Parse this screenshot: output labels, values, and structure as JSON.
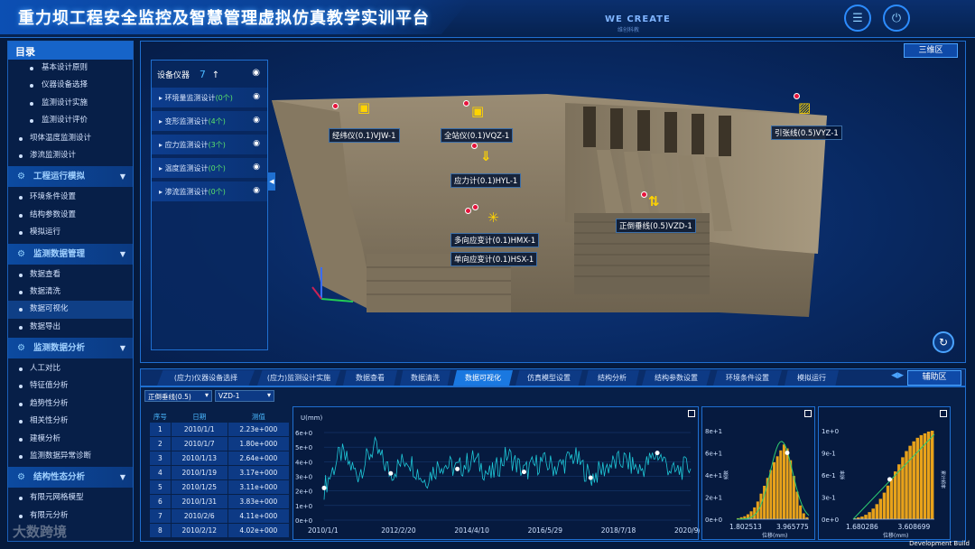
{
  "header": {
    "title": "重力坝工程安全监控及智慧管理虚拟仿真教学实训平台",
    "brand": "WE CREATE",
    "brand_sub": "维创科教",
    "btn_menu_icon": "menu-icon",
    "btn_power_icon": "power-icon"
  },
  "sidebar": {
    "title": "目录",
    "items": [
      {
        "type": "sub",
        "label": "基本设计原则"
      },
      {
        "type": "sub",
        "label": "仪器设备选择"
      },
      {
        "type": "sub",
        "label": "监测设计实施"
      },
      {
        "type": "sub",
        "label": "监测设计评价"
      },
      {
        "type": "item",
        "label": "坝体温度监测设计"
      },
      {
        "type": "item",
        "label": "渗流监测设计"
      },
      {
        "type": "section",
        "label": "工程运行模拟"
      },
      {
        "type": "item",
        "label": "环境条件设置"
      },
      {
        "type": "item",
        "label": "结构参数设置"
      },
      {
        "type": "item",
        "label": "模拟运行"
      },
      {
        "type": "section",
        "label": "监测数据管理"
      },
      {
        "type": "item",
        "label": "数据查看"
      },
      {
        "type": "item",
        "label": "数据清洗"
      },
      {
        "type": "item",
        "label": "数据可视化",
        "active": true
      },
      {
        "type": "item",
        "label": "数据导出"
      },
      {
        "type": "section",
        "label": "监测数据分析"
      },
      {
        "type": "item",
        "label": "人工对比"
      },
      {
        "type": "item",
        "label": "特征值分析"
      },
      {
        "type": "item",
        "label": "趋势性分析"
      },
      {
        "type": "item",
        "label": "相关性分析"
      },
      {
        "type": "item",
        "label": "建模分析"
      },
      {
        "type": "item",
        "label": "监测数据异常诊断"
      },
      {
        "type": "section",
        "label": "结构性态分析"
      },
      {
        "type": "item",
        "label": "有限元网格模型"
      },
      {
        "type": "item",
        "label": "有限元分析"
      }
    ]
  },
  "viewport": {
    "tab_label": "三维区",
    "panel_title": "设备仪器",
    "panel_count": "7",
    "panel_arrow": "↑",
    "rows": [
      {
        "label": "环境量监测设计",
        "count": "(0个)"
      },
      {
        "label": "变形监测设计",
        "count": "(4个)"
      },
      {
        "label": "应力监测设计",
        "count": "(3个)"
      },
      {
        "label": "温度监测设计",
        "count": "(0个)"
      },
      {
        "label": "渗流监测设计",
        "count": "(0个)"
      }
    ],
    "sensors": {
      "s1": "经纬仪(0.1)VJW-1",
      "s2": "全站仪(0.1)VQZ-1",
      "s3": "引张线(0.5)VYZ-1",
      "s4": "应力计(0.1)HYL-1",
      "s5": "正倒垂线(0.5)VZD-1",
      "s6": "多向应变计(0.1)HMX-1",
      "s7": "单向应变计(0.1)HSX-1"
    }
  },
  "tabs": {
    "items": [
      "(应力)仪器设备选择",
      "(应力)监测设计实施",
      "数据查看",
      "数据清洗",
      "数据可视化",
      "仿真模型设置",
      "结构分析",
      "结构参数设置",
      "环境条件设置",
      "模拟运行"
    ],
    "active_index": 4,
    "aux_label": "辅助区"
  },
  "bottom": {
    "select_type": "正倒垂线(0.5)",
    "select_id": "VZD-1",
    "table": {
      "headers": [
        "序号",
        "日期",
        "测值"
      ],
      "rows": [
        [
          "1",
          "2010/1/1",
          "2.23e+000"
        ],
        [
          "2",
          "2010/1/7",
          "1.80e+000"
        ],
        [
          "3",
          "2010/1/13",
          "2.64e+000"
        ],
        [
          "4",
          "2010/1/19",
          "3.17e+000"
        ],
        [
          "5",
          "2010/1/25",
          "3.11e+000"
        ],
        [
          "6",
          "2010/1/31",
          "3.83e+000"
        ],
        [
          "7",
          "2010/2/6",
          "4.11e+000"
        ],
        [
          "8",
          "2010/2/12",
          "4.02e+000"
        ]
      ]
    }
  },
  "chart_data": [
    {
      "type": "line",
      "ylabel": "U(mm)",
      "ylim": [
        0,
        6
      ],
      "yticks": [
        "6e+0",
        "5e+0",
        "4e+0",
        "3e+0",
        "2e+0",
        "1e+0",
        "0e+0"
      ],
      "xticks": [
        "2010/1/1",
        "2012/2/20",
        "2014/4/10",
        "2016/5/29",
        "2018/7/18",
        "2020/9/5"
      ],
      "series_color": "#1ec8d8",
      "x": [
        "2010/1/1",
        "2010/7/1",
        "2011/1/1",
        "2011/7/1",
        "2012/1/1",
        "2012/7/1",
        "2013/1/1",
        "2013/7/1",
        "2014/1/1",
        "2014/7/1",
        "2015/1/1",
        "2015/7/1",
        "2016/1/1",
        "2016/7/1",
        "2017/1/1",
        "2017/7/1",
        "2018/1/1",
        "2018/7/1",
        "2019/1/1",
        "2019/7/1",
        "2020/1/1",
        "2020/7/1",
        "2021/1/1"
      ],
      "values": [
        2.2,
        4.6,
        3.1,
        5.0,
        3.2,
        4.3,
        2.7,
        3.9,
        3.5,
        4.2,
        3.0,
        4.5,
        3.3,
        4.0,
        3.6,
        4.4,
        2.9,
        3.7,
        4.1,
        3.4,
        4.6,
        3.2,
        3.8
      ]
    },
    {
      "type": "bar",
      "xlabel": "位移(mm)",
      "ylabel": "频数",
      "yticks": [
        "8e+1",
        "6e+1",
        "4e+1",
        "2e+1",
        "0e+0"
      ],
      "xticks": [
        "1.802513",
        "3.965775"
      ],
      "ylim": [
        0,
        90
      ],
      "bar_color": "#e8a21a",
      "values": [
        1,
        2,
        3,
        5,
        8,
        12,
        18,
        26,
        34,
        42,
        50,
        58,
        64,
        70,
        76,
        72,
        60,
        44,
        28,
        14,
        6,
        2
      ]
    },
    {
      "type": "bar",
      "xlabel": "位移(mm)",
      "ylabel": "频率",
      "y2label": "累计频率",
      "yticks": [
        "1e+0",
        "9e-1",
        "6e-1",
        "3e-1",
        "0e+0"
      ],
      "xticks": [
        "1.680286",
        "3.608699"
      ],
      "ylim": [
        0,
        1
      ],
      "bar_color": "#e8a21a",
      "values": [
        0.01,
        0.02,
        0.03,
        0.05,
        0.08,
        0.12,
        0.17,
        0.23,
        0.3,
        0.38,
        0.46,
        0.54,
        0.62,
        0.7,
        0.77,
        0.83,
        0.88,
        0.92,
        0.95,
        0.97,
        0.99,
        1.0
      ]
    }
  ],
  "footer": {
    "dev_build": "Development Build",
    "watermark": "大数跨境"
  }
}
